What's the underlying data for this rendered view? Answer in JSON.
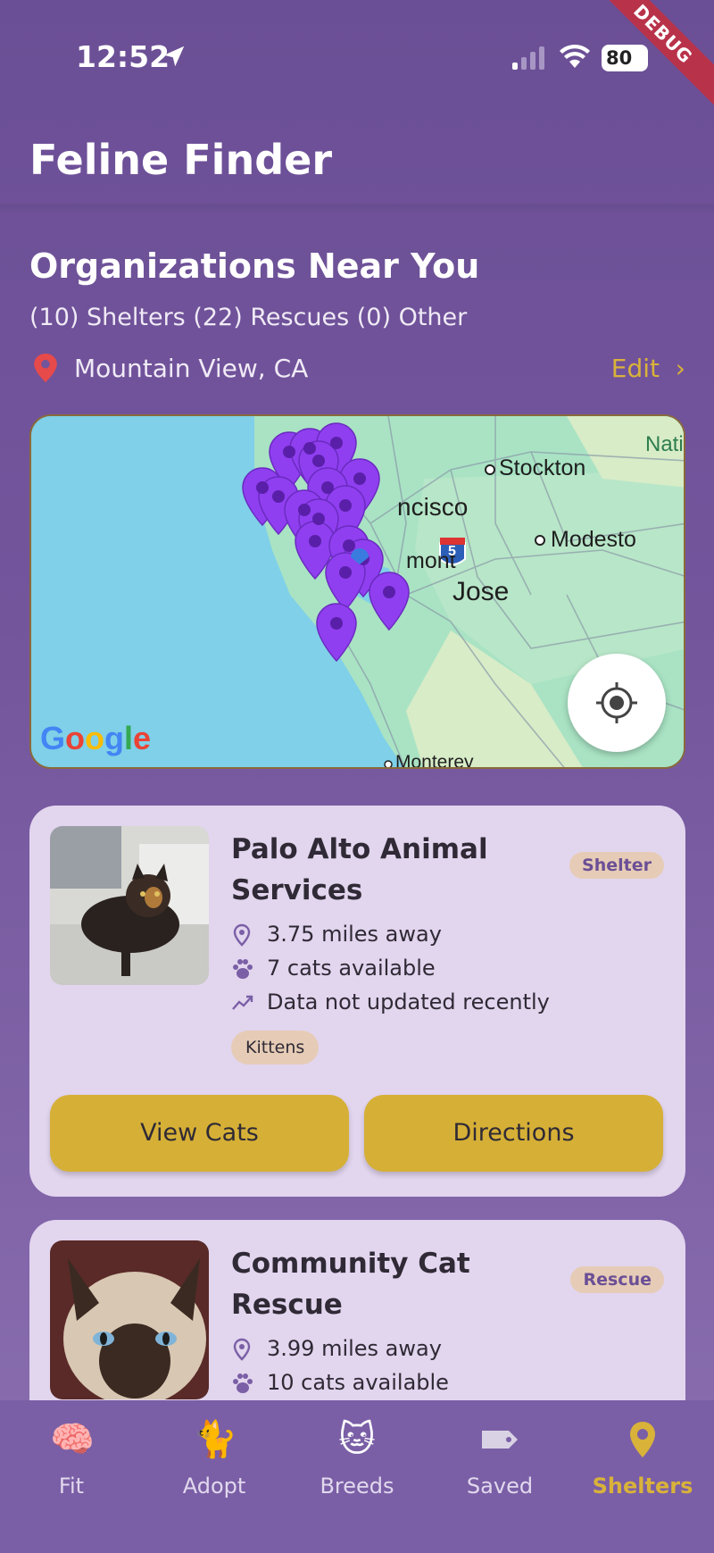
{
  "status_bar": {
    "time": "12:52",
    "battery": "80",
    "debug_label": "DEBUG"
  },
  "app": {
    "title": "Feline Finder"
  },
  "orgs": {
    "title": "Organizations Near You",
    "counts": "(10) Shelters (22) Rescues (0) Other",
    "location": "Mountain View, CA",
    "edit_label": "Edit"
  },
  "map": {
    "labels": {
      "stockton": "Stockton",
      "francisco": "ncisco",
      "modesto": "Modesto",
      "fremont": "mont",
      "jose": "Jose",
      "monterey": "Monterey",
      "natl": "Nati",
      "interstate": "5"
    },
    "google_logo": "Google",
    "marker_color": "#8f3ff0"
  },
  "cards": [
    {
      "name": "Palo Alto Animal Services",
      "badge": "Shelter",
      "distance": "3.75 miles away",
      "cats": "7 cats available",
      "updated": "Data not updated recently",
      "tag": "Kittens",
      "view_label": "View Cats",
      "directions_label": "Directions"
    },
    {
      "name": "Community Cat Rescue",
      "badge": "Rescue",
      "distance": "3.99 miles away",
      "cats": "10 cats available"
    }
  ],
  "tabs": [
    {
      "label": "Fit",
      "icon": "brain-icon"
    },
    {
      "label": "Adopt",
      "icon": "cat-icon"
    },
    {
      "label": "Breeds",
      "icon": "cat-face-icon"
    },
    {
      "label": "Saved",
      "icon": "tag-icon"
    },
    {
      "label": "Shelters",
      "icon": "location-pin-icon"
    }
  ],
  "colors": {
    "accent": "#d9b23a",
    "background": "#6b4f96",
    "card": "#e2d5ee"
  }
}
